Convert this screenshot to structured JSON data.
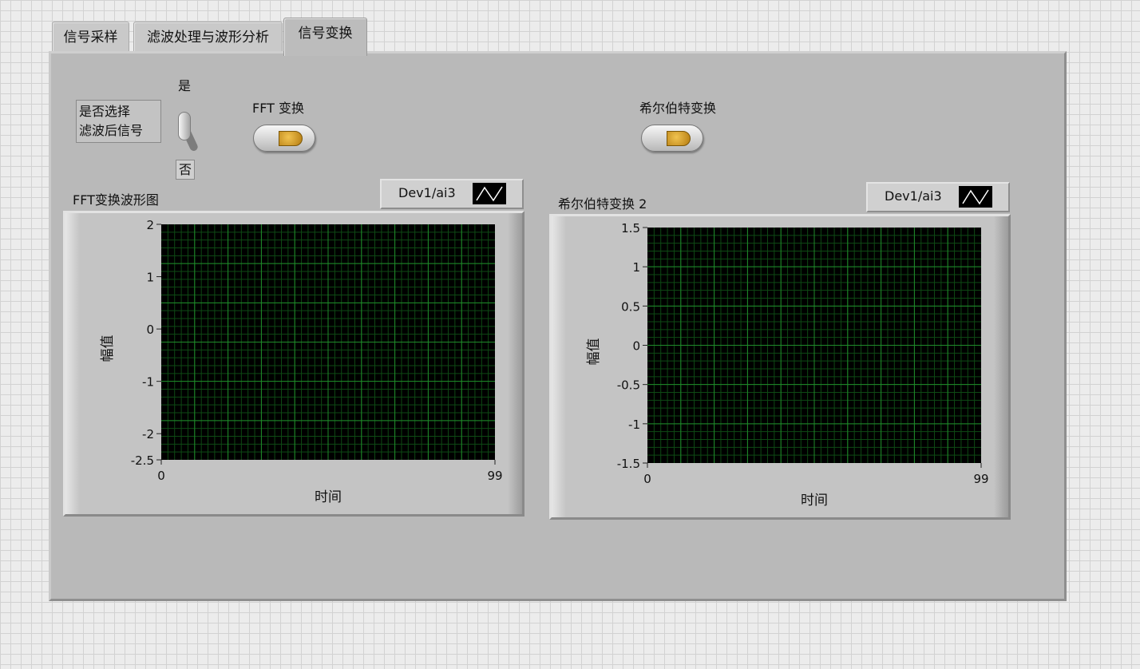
{
  "tabs": [
    {
      "label": "信号采样",
      "active": false
    },
    {
      "label": "滤波处理与波形分析",
      "active": false
    },
    {
      "label": "信号变换",
      "active": true
    }
  ],
  "filter_switch": {
    "label_line1": "是否选择",
    "label_line2": "滤波后信号",
    "on_label": "是",
    "off_label": "否"
  },
  "buttons": {
    "fft_label": "FFT 变换",
    "hilbert_label": "希尔伯特变换"
  },
  "graphs": [
    {
      "title": "FFT变换波形图",
      "legend": "Dev1/ai3",
      "ylabel": "幅值",
      "xlabel": "时间",
      "x_ticks": [
        "0",
        "99"
      ],
      "y_ticks": [
        "2",
        "1",
        "0",
        "-1",
        "-2",
        "-2.5"
      ],
      "ylim": [
        -2.5,
        2
      ],
      "xlim": [
        0,
        99
      ]
    },
    {
      "title": "希尔伯特变换 2",
      "legend": "Dev1/ai3",
      "ylabel": "幅值",
      "xlabel": "时间",
      "x_ticks": [
        "0",
        "99"
      ],
      "y_ticks": [
        "1.5",
        "1",
        "0.5",
        "0",
        "-0.5",
        "-1",
        "-1.5"
      ],
      "ylim": [
        -1.5,
        1.5
      ],
      "xlim": [
        0,
        99
      ]
    }
  ],
  "colors": {
    "plot_bg": "#000000",
    "grid_major": "#1f8a2a",
    "grid_minor": "#0e4a14",
    "panel_bg": "#b9b9b9"
  }
}
